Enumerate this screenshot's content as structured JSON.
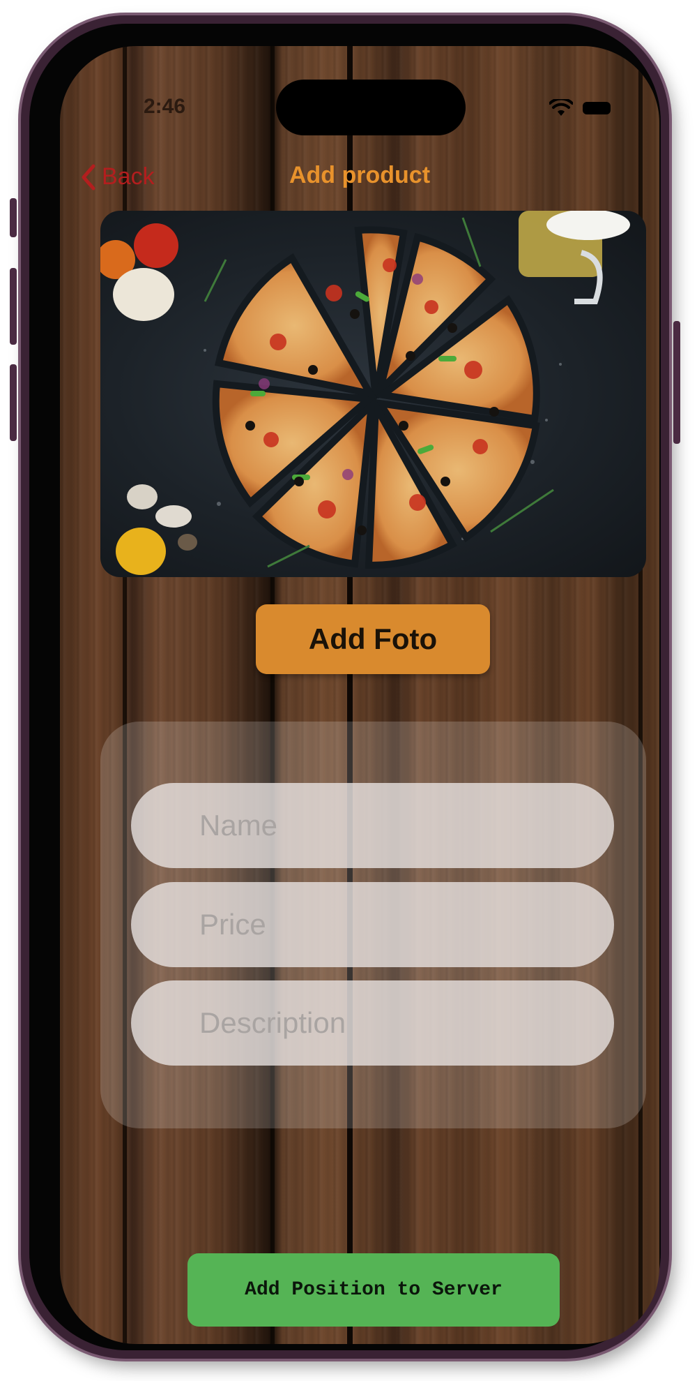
{
  "status_bar": {
    "time": "2:46",
    "icons": [
      "wifi-icon",
      "battery-icon"
    ]
  },
  "nav": {
    "back_label": "Back",
    "back_icon": "chevron-left-icon",
    "title": "Add product"
  },
  "photo": {
    "subject": "pizza-photo"
  },
  "add_photo_button": {
    "label": "Add Foto"
  },
  "form": {
    "name": {
      "value": "",
      "placeholder": "Name"
    },
    "price": {
      "value": "",
      "placeholder": "Price"
    },
    "description": {
      "value": "",
      "placeholder": "Description"
    }
  },
  "submit_button": {
    "label": "Add Position to Server"
  },
  "colors": {
    "back": "#b31e1e",
    "title": "#e8922c",
    "add_photo": "#d98a2e",
    "submit": "#55b455"
  }
}
